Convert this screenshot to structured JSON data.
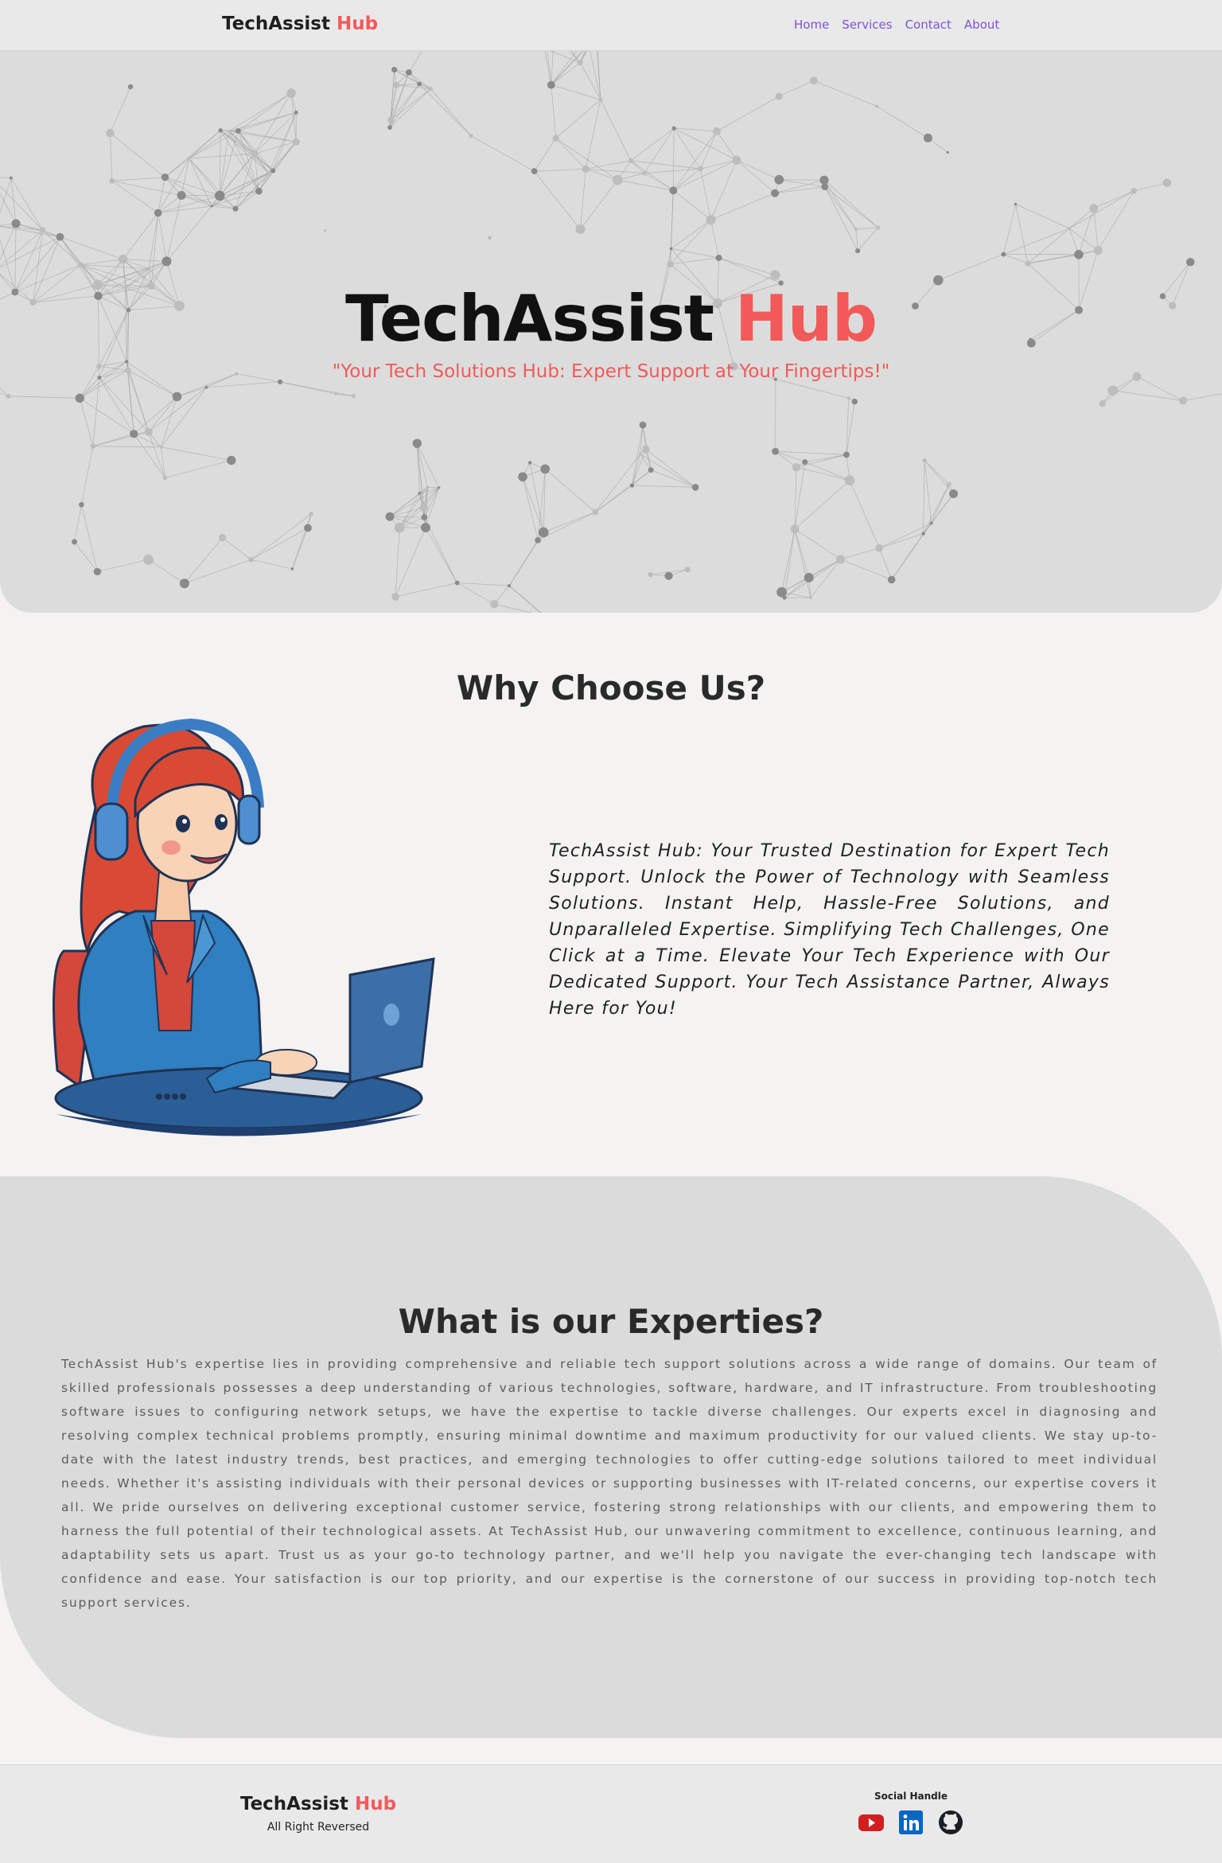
{
  "nav": {
    "brand_main": "TechAssist",
    "brand_accent": "Hub",
    "links": [
      "Home",
      "Services",
      "Contact",
      "About"
    ]
  },
  "hero": {
    "title_main": "TechAssist",
    "title_accent": "Hub",
    "tagline": "\"Your Tech Solutions Hub: Expert Support at Your Fingertips!\""
  },
  "why": {
    "heading": "Why Choose Us?",
    "body": "TechAssist Hub: Your Trusted Destination for Expert Tech Support. Unlock the Power of Technology with Seamless Solutions. Instant Help, Hassle-Free Solutions, and Unparalleled Expertise. Simplifying Tech Challenges, One Click at a Time. Elevate Your Tech Experience with Our Dedicated Support. Your Tech Assistance Partner, Always Here for You!"
  },
  "expertise": {
    "heading": "What is our Experties?",
    "body": "TechAssist Hub's expertise lies in providing comprehensive and reliable tech support solutions across a wide range of domains. Our team of skilled professionals possesses a deep understanding of various technologies, software, hardware, and IT infrastructure. From troubleshooting software issues to configuring network setups, we have the expertise to tackle diverse challenges. Our experts excel in diagnosing and resolving complex technical problems promptly, ensuring minimal downtime and maximum productivity for our valued clients. We stay up-to-date with the latest industry trends, best practices, and emerging technologies to offer cutting-edge solutions tailored to meet individual needs. Whether it's assisting individuals with their personal devices or supporting businesses with IT-related concerns, our expertise covers it all. We pride ourselves on delivering exceptional customer service, fostering strong relationships with our clients, and empowering them to harness the full potential of their technological assets. At TechAssist Hub, our unwavering commitment to excellence, continuous learning, and adaptability sets us apart. Trust us as your go-to technology partner, and we'll help you navigate the ever-changing tech landscape with confidence and ease. Your satisfaction is our top priority, and our expertise is the cornerstone of our success in providing top-notch tech support services."
  },
  "footer": {
    "brand_main": "TechAssist",
    "brand_accent": "Hub",
    "rights": "All Right Reversed",
    "social_label": "Social Handle",
    "icons": [
      "youtube-icon",
      "linkedin-icon",
      "github-icon"
    ]
  },
  "colors": {
    "accent": "#f25a5a",
    "nav_link": "#7a55d8",
    "hero_bg": "#dcdcdc",
    "page_bg": "#f4f3f2"
  }
}
